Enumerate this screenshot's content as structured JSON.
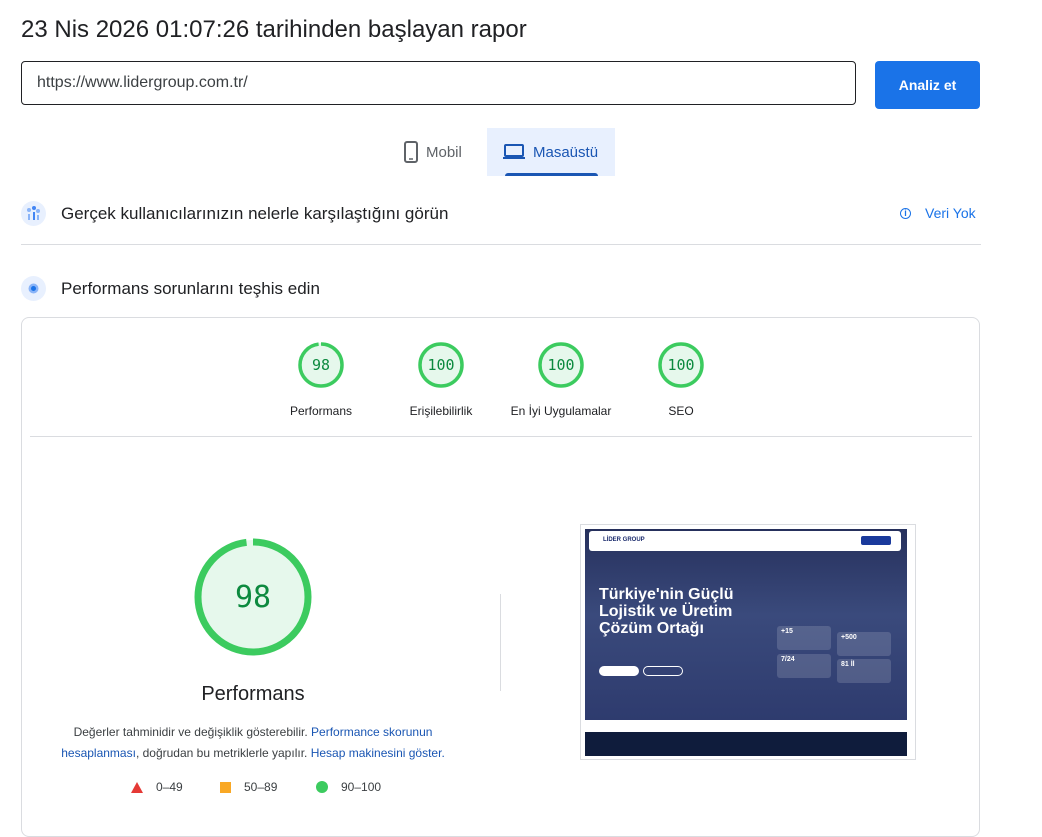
{
  "header": {
    "title": "23 Nis 2026 01:07:26 tarihinden başlayan rapor",
    "url_value": "https://www.lidergroup.com.tr/",
    "analyze_label": "Analiz et"
  },
  "tabs": [
    {
      "label": "Mobil",
      "icon": "phone-icon",
      "active": false
    },
    {
      "label": "Masaüstü",
      "icon": "laptop-icon",
      "active": true
    }
  ],
  "field_data": {
    "heading": "Gerçek kullanıcılarınızın nelerle karşılaştığını görün",
    "status": "Veri Yok"
  },
  "diagnostics": {
    "heading": "Performans sorunlarını teşhis edin"
  },
  "scores": [
    {
      "label": "Performans",
      "value": "98"
    },
    {
      "label": "Erişilebilirlik",
      "value": "100"
    },
    {
      "label": "En İyi Uygulamalar",
      "value": "100"
    },
    {
      "label": "SEO",
      "value": "100"
    }
  ],
  "performance": {
    "score": "98",
    "label": "Performans",
    "note_text1": "Değerler tahminidir ve değişiklik gösterebilir. ",
    "note_link1": "Performance skorunun hesaplanması",
    "note_text2": ", doğrudan bu metriklerle yapılır. ",
    "note_link2": "Hesap makinesini göster."
  },
  "legend": [
    {
      "range": "0–49",
      "color": "#e53935",
      "shape": "triangle"
    },
    {
      "range": "50–89",
      "color": "#f9a825",
      "shape": "square"
    },
    {
      "range": "90–100",
      "color": "#3ccb5f",
      "shape": "circle"
    }
  ],
  "screenshot": {
    "logo": "LİDER GROUP",
    "headline1": "Türkiye'nin Güçlü",
    "headline2": "Lojistik ve Üretim",
    "headline3": "Çözüm Ortağı",
    "stat1": "+15",
    "stat2": "+500",
    "stat3": "7/24",
    "stat4": "81 İl"
  },
  "colors": {
    "accent": "#1a73e8",
    "good": "#0cce6b",
    "good_text": "#0d8a3f"
  }
}
